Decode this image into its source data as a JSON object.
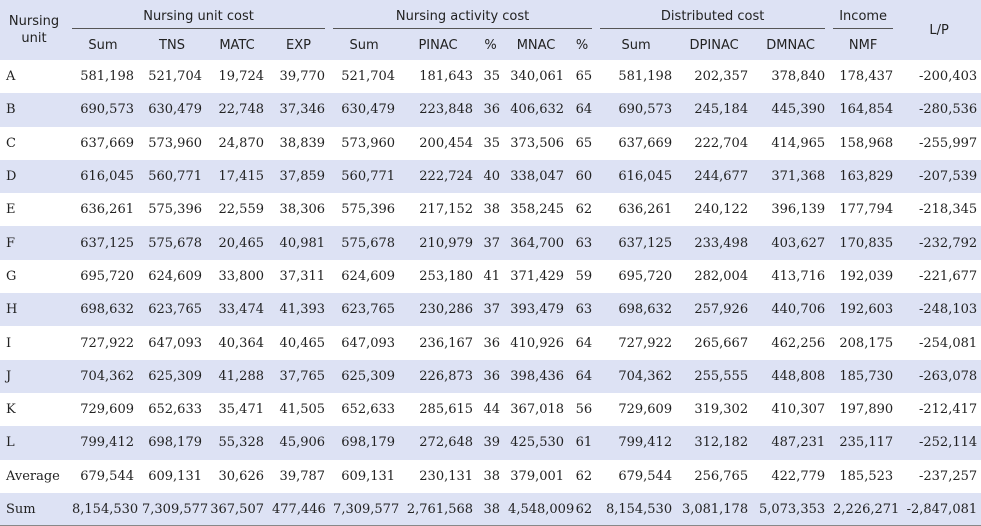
{
  "headers": {
    "stub": "Nursing unit",
    "groups": [
      "Nursing unit cost",
      "Nursing activity cost",
      "Distributed cost",
      "Income"
    ],
    "lp": "L/P",
    "subs": [
      "Sum",
      "TNS",
      "MATC",
      "EXP",
      "Sum",
      "PINAC",
      "%",
      "MNAC",
      "%",
      "Sum",
      "DPINAC",
      "DMNAC",
      "NMF"
    ]
  },
  "rows": [
    [
      "A",
      "581,198",
      "521,704",
      "19,724",
      "39,770",
      "521,704",
      "181,643",
      "35",
      "340,061",
      "65",
      "581,198",
      "202,357",
      "378,840",
      "178,437",
      "-200,403"
    ],
    [
      "B",
      "690,573",
      "630,479",
      "22,748",
      "37,346",
      "630,479",
      "223,848",
      "36",
      "406,632",
      "64",
      "690,573",
      "245,184",
      "445,390",
      "164,854",
      "-280,536"
    ],
    [
      "C",
      "637,669",
      "573,960",
      "24,870",
      "38,839",
      "573,960",
      "200,454",
      "35",
      "373,506",
      "65",
      "637,669",
      "222,704",
      "414,965",
      "158,968",
      "-255,997"
    ],
    [
      "D",
      "616,045",
      "560,771",
      "17,415",
      "37,859",
      "560,771",
      "222,724",
      "40",
      "338,047",
      "60",
      "616,045",
      "244,677",
      "371,368",
      "163,829",
      "-207,539"
    ],
    [
      "E",
      "636,261",
      "575,396",
      "22,559",
      "38,306",
      "575,396",
      "217,152",
      "38",
      "358,245",
      "62",
      "636,261",
      "240,122",
      "396,139",
      "177,794",
      "-218,345"
    ],
    [
      "F",
      "637,125",
      "575,678",
      "20,465",
      "40,981",
      "575,678",
      "210,979",
      "37",
      "364,700",
      "63",
      "637,125",
      "233,498",
      "403,627",
      "170,835",
      "-232,792"
    ],
    [
      "G",
      "695,720",
      "624,609",
      "33,800",
      "37,311",
      "624,609",
      "253,180",
      "41",
      "371,429",
      "59",
      "695,720",
      "282,004",
      "413,716",
      "192,039",
      "-221,677"
    ],
    [
      "H",
      "698,632",
      "623,765",
      "33,474",
      "41,393",
      "623,765",
      "230,286",
      "37",
      "393,479",
      "63",
      "698,632",
      "257,926",
      "440,706",
      "192,603",
      "-248,103"
    ],
    [
      "I",
      "727,922",
      "647,093",
      "40,364",
      "40,465",
      "647,093",
      "236,167",
      "36",
      "410,926",
      "64",
      "727,922",
      "265,667",
      "462,256",
      "208,175",
      "-254,081"
    ],
    [
      "J",
      "704,362",
      "625,309",
      "41,288",
      "37,765",
      "625,309",
      "226,873",
      "36",
      "398,436",
      "64",
      "704,362",
      "255,555",
      "448,808",
      "185,730",
      "-263,078"
    ],
    [
      "K",
      "729,609",
      "652,633",
      "35,471",
      "41,505",
      "652,633",
      "285,615",
      "44",
      "367,018",
      "56",
      "729,609",
      "319,302",
      "410,307",
      "197,890",
      "-212,417"
    ],
    [
      "L",
      "799,412",
      "698,179",
      "55,328",
      "45,906",
      "698,179",
      "272,648",
      "39",
      "425,530",
      "61",
      "799,412",
      "312,182",
      "487,231",
      "235,117",
      "-252,114"
    ],
    [
      "Average",
      "679,544",
      "609,131",
      "30,626",
      "39,787",
      "609,131",
      "230,131",
      "38",
      "379,001",
      "62",
      "679,544",
      "256,765",
      "422,779",
      "185,523",
      "-237,257"
    ],
    [
      "Sum",
      "8,154,530",
      "7,309,577",
      "367,507",
      "477,446",
      "7,309,577",
      "2,761,568",
      "38",
      "4,548,009",
      "62",
      "8,154,530",
      "3,081,178",
      "5,073,353",
      "2,226,271",
      "-2,847,081"
    ]
  ]
}
